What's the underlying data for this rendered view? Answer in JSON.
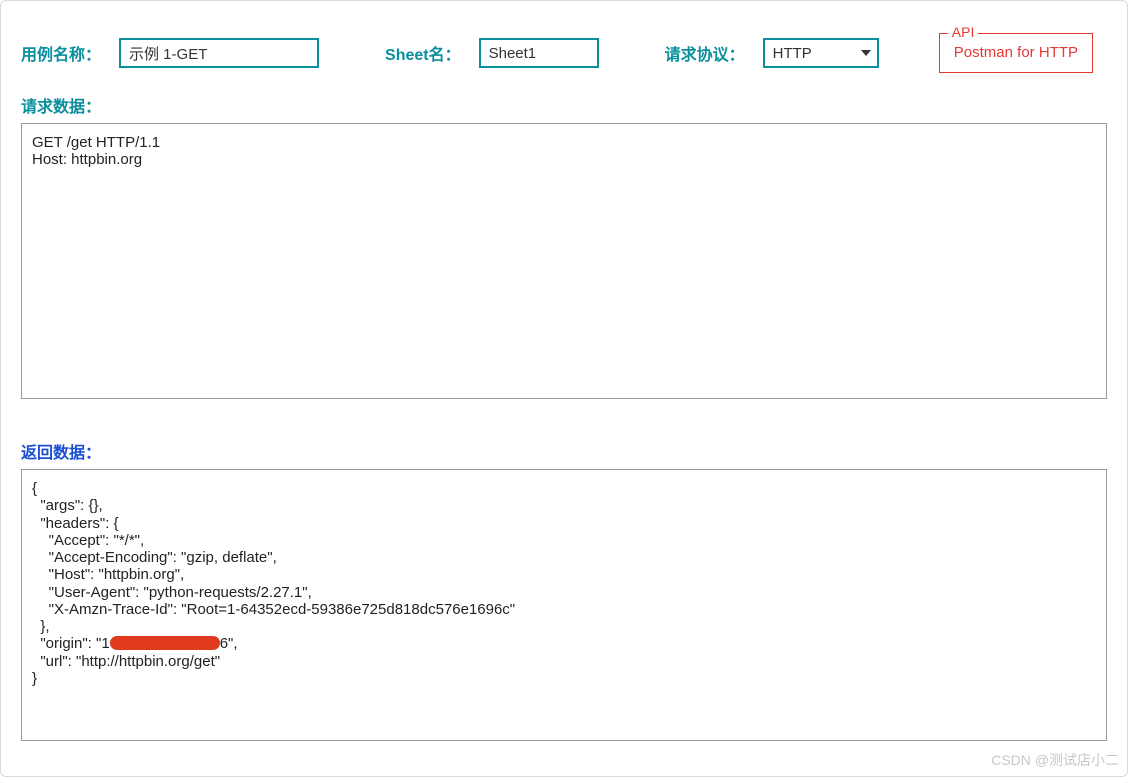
{
  "header": {
    "name_label": "用例名称：",
    "name_value": "示例 1-GET",
    "sheet_label": "Sheet名：",
    "sheet_value": "Sheet1",
    "protocol_label": "请求协议：",
    "protocol_value": "HTTP"
  },
  "api_box": {
    "legend": "API",
    "link_text": "Postman for HTTP"
  },
  "request": {
    "label": "请求数据：",
    "body": "GET /get HTTP/1.1\nHost: httpbin.org"
  },
  "response": {
    "label": "返回数据：",
    "line1": "{",
    "line2": "  \"args\": {},",
    "line3": "  \"headers\": {",
    "line4": "    \"Accept\": \"*/*\",",
    "line5": "    \"Accept-Encoding\": \"gzip, deflate\",",
    "line6": "    \"Host\": \"httpbin.org\",",
    "line7": "    \"User-Agent\": \"python-requests/2.27.1\",",
    "line8": "    \"X-Amzn-Trace-Id\": \"Root=1-64352ecd-59386e725d818dc576e1696c\"",
    "line9": "  },",
    "origin_prefix": "  \"origin\": \"1",
    "origin_suffix": "6\",",
    "line11": "  \"url\": \"http://httpbin.org/get\"",
    "line12": "}"
  },
  "watermark": "CSDN @测试店小二"
}
